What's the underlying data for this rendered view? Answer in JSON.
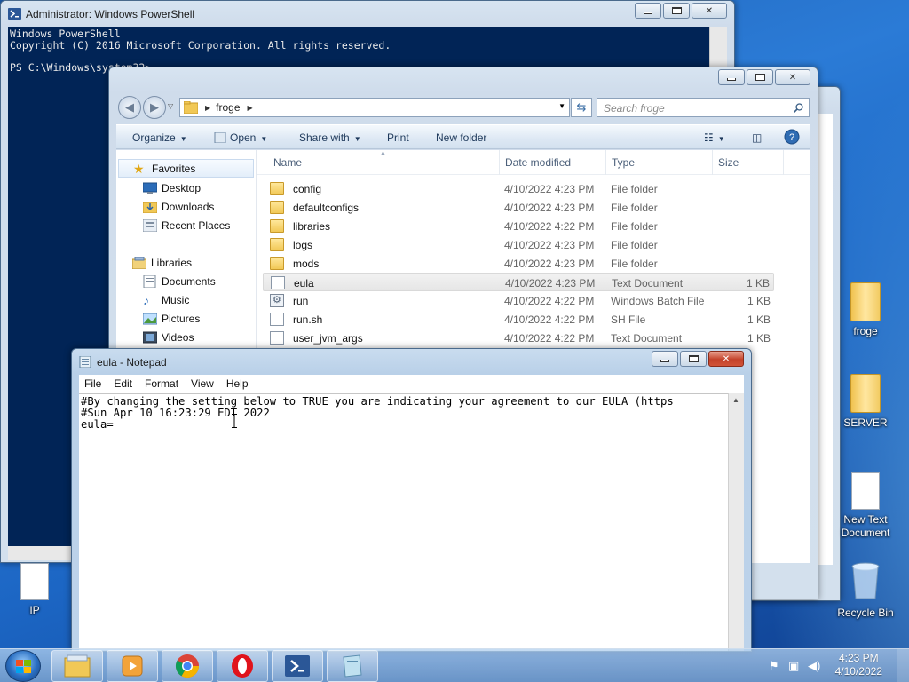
{
  "colors": {
    "powershell_bg": "#012456",
    "desktop_bg": "#1e5fb3",
    "close_red": "#c4422a"
  },
  "powershell": {
    "title": "Administrator: Windows PowerShell",
    "lines": [
      "Windows PowerShell",
      "Copyright (C) 2016 Microsoft Corporation. All rights reserved.",
      "",
      "PS C:\\Windows\\system32>"
    ]
  },
  "explorer": {
    "path_segment": "froge",
    "search_placeholder": "Search froge",
    "toolbar": {
      "organize": "Organize",
      "open": "Open",
      "share_with": "Share with",
      "print": "Print",
      "new_folder": "New folder"
    },
    "nav": {
      "favorites": "Favorites",
      "desktop": "Desktop",
      "downloads": "Downloads",
      "recent_places": "Recent Places",
      "libraries": "Libraries",
      "documents": "Documents",
      "music": "Music",
      "pictures": "Pictures",
      "videos": "Videos"
    },
    "columns": {
      "name": "Name",
      "date": "Date modified",
      "type": "Type",
      "size": "Size"
    },
    "files": [
      {
        "icon": "folder-icon",
        "name": "config",
        "date": "4/10/2022 4:23 PM",
        "type": "File folder",
        "size": ""
      },
      {
        "icon": "folder-icon",
        "name": "defaultconfigs",
        "date": "4/10/2022 4:23 PM",
        "type": "File folder",
        "size": ""
      },
      {
        "icon": "folder-icon",
        "name": "libraries",
        "date": "4/10/2022 4:22 PM",
        "type": "File folder",
        "size": ""
      },
      {
        "icon": "folder-icon",
        "name": "logs",
        "date": "4/10/2022 4:23 PM",
        "type": "File folder",
        "size": ""
      },
      {
        "icon": "folder-icon",
        "name": "mods",
        "date": "4/10/2022 4:23 PM",
        "type": "File folder",
        "size": ""
      },
      {
        "icon": "document-icon",
        "name": "eula",
        "date": "4/10/2022 4:23 PM",
        "type": "Text Document",
        "size": "1 KB",
        "selected": true
      },
      {
        "icon": "batch-file-icon",
        "name": "run",
        "date": "4/10/2022 4:22 PM",
        "type": "Windows Batch File",
        "size": "1 KB"
      },
      {
        "icon": "document-icon",
        "name": "run.sh",
        "date": "4/10/2022 4:22 PM",
        "type": "SH File",
        "size": "1 KB"
      },
      {
        "icon": "document-icon",
        "name": "user_jvm_args",
        "date": "4/10/2022 4:22 PM",
        "type": "Text Document",
        "size": "1 KB"
      }
    ]
  },
  "notepad": {
    "title": "eula - Notepad",
    "menu": {
      "file": "File",
      "edit": "Edit",
      "format": "Format",
      "view": "View",
      "help": "Help"
    },
    "text": "#By changing the setting below to TRUE you are indicating your agreement to our EULA (https\n#Sun Apr 10 16:23:29 EDT 2022\neula="
  },
  "desktop_icons": {
    "froge": "froge",
    "server": "SERVER",
    "new_text": "New Text Document",
    "recycle": "Recycle Bin",
    "ip": "IP"
  },
  "taskbar": {
    "clock_time": "4:23 PM",
    "clock_date": "4/10/2022",
    "pinned": [
      "explorer-icon",
      "media-player-icon",
      "chrome-icon",
      "opera-icon",
      "powershell-icon",
      "notepad-icon"
    ]
  }
}
